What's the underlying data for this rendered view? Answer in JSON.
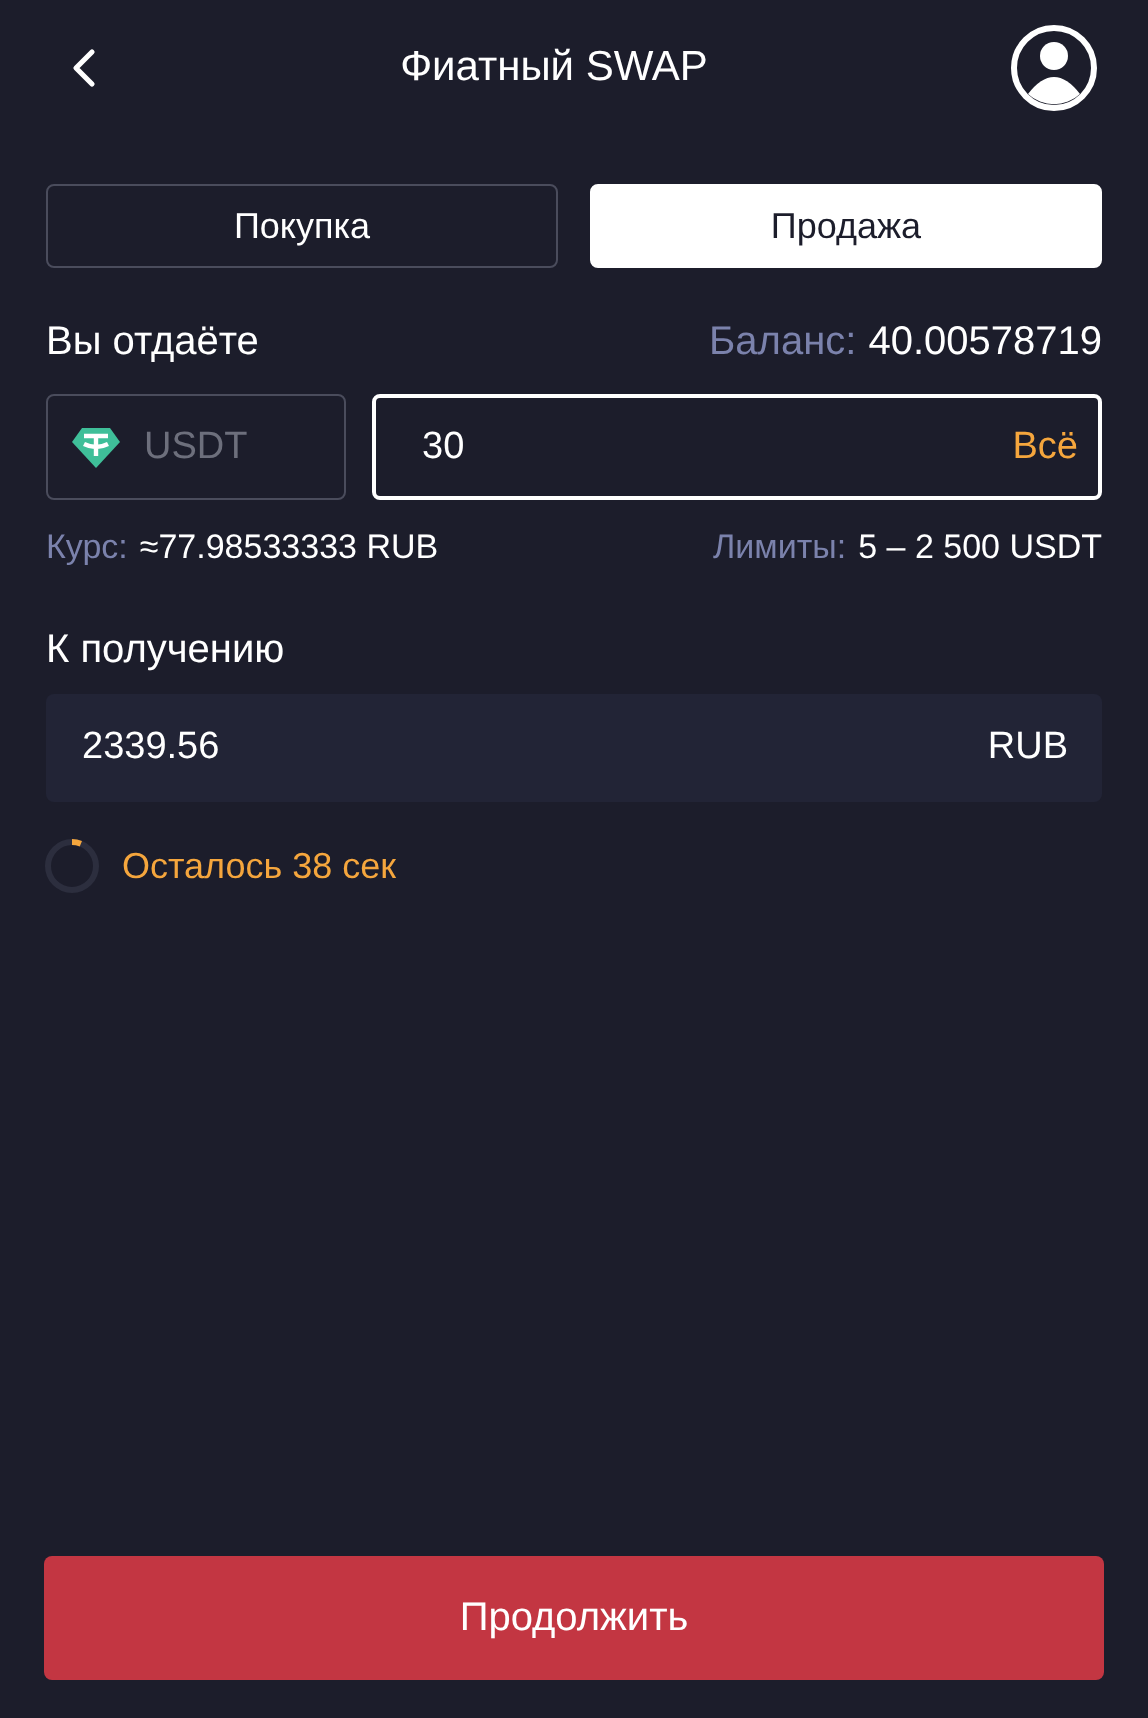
{
  "header": {
    "title": "Фиатный SWAP"
  },
  "tabs": [
    {
      "label": "Покупка",
      "selected": false
    },
    {
      "label": "Продажа",
      "selected": true
    }
  ],
  "give": {
    "label": "Вы отдаёте",
    "balance_label": "Баланс:",
    "balance": "40.00578719",
    "currency": "USDT",
    "amount": "30",
    "all_button": "Всё"
  },
  "rate": {
    "label": "Курс:",
    "value": "≈77.98533333 RUB",
    "limits_label": "Лимиты:",
    "limits": "5 – 2 500 USDT"
  },
  "receive": {
    "label": "К получению",
    "amount": "2339.56",
    "currency": "RUB"
  },
  "timer": {
    "text": "Осталось 38 сек",
    "level": 0.06
  },
  "continue_button": "Продолжить"
}
